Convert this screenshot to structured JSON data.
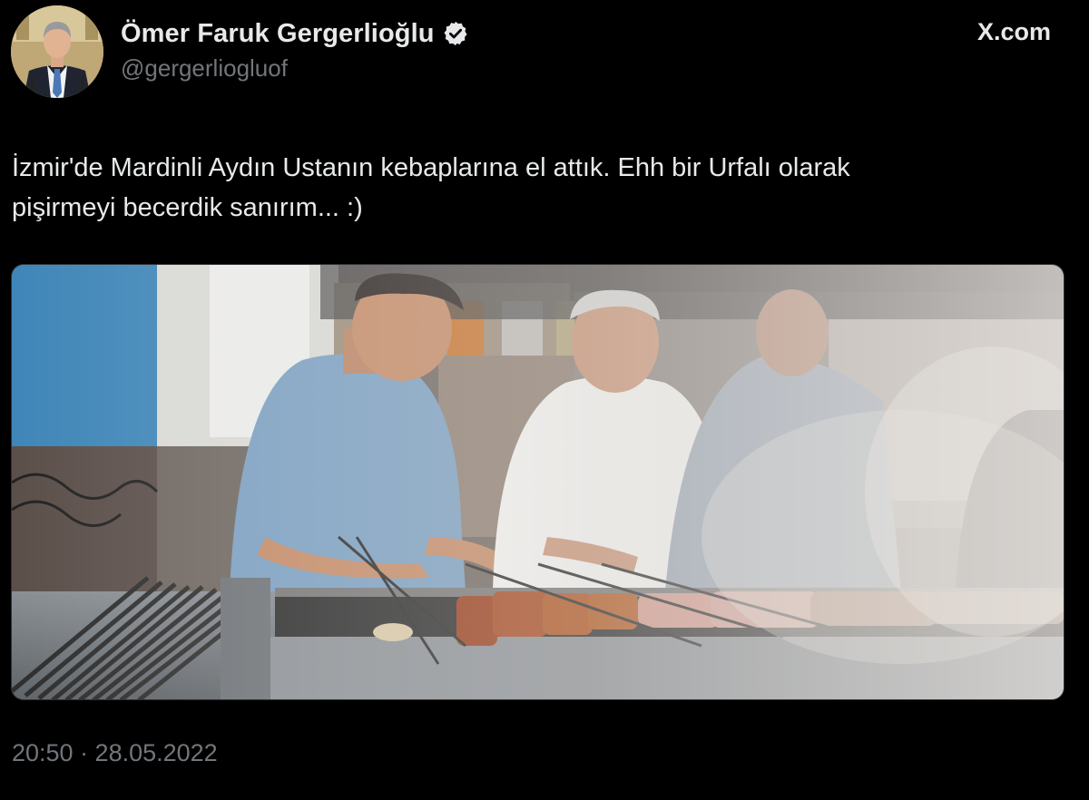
{
  "tweet": {
    "author": {
      "display_name": "Ömer Faruk Gergerlioğlu",
      "handle": "@gergerliogluof",
      "verified": true,
      "avatar_icon": "profile-photo"
    },
    "site": "X.com",
    "text_lines": [
      "İzmir'de Mardinli Aydın Ustanın kebaplarına el attık. Ehh bir Urfalı olarak",
      "pişirmeyi becerdik sanırım... :)"
    ],
    "media": {
      "type": "photo",
      "subject_icon": "kebab-grill-photo"
    },
    "timestamp": "20:50 · 28.05.2022"
  },
  "colors": {
    "background": "#000000",
    "primary_text": "#e7e9ea",
    "secondary_text": "#71767b",
    "verified_badge": "#e7e9ea",
    "border": "#2f3336"
  }
}
